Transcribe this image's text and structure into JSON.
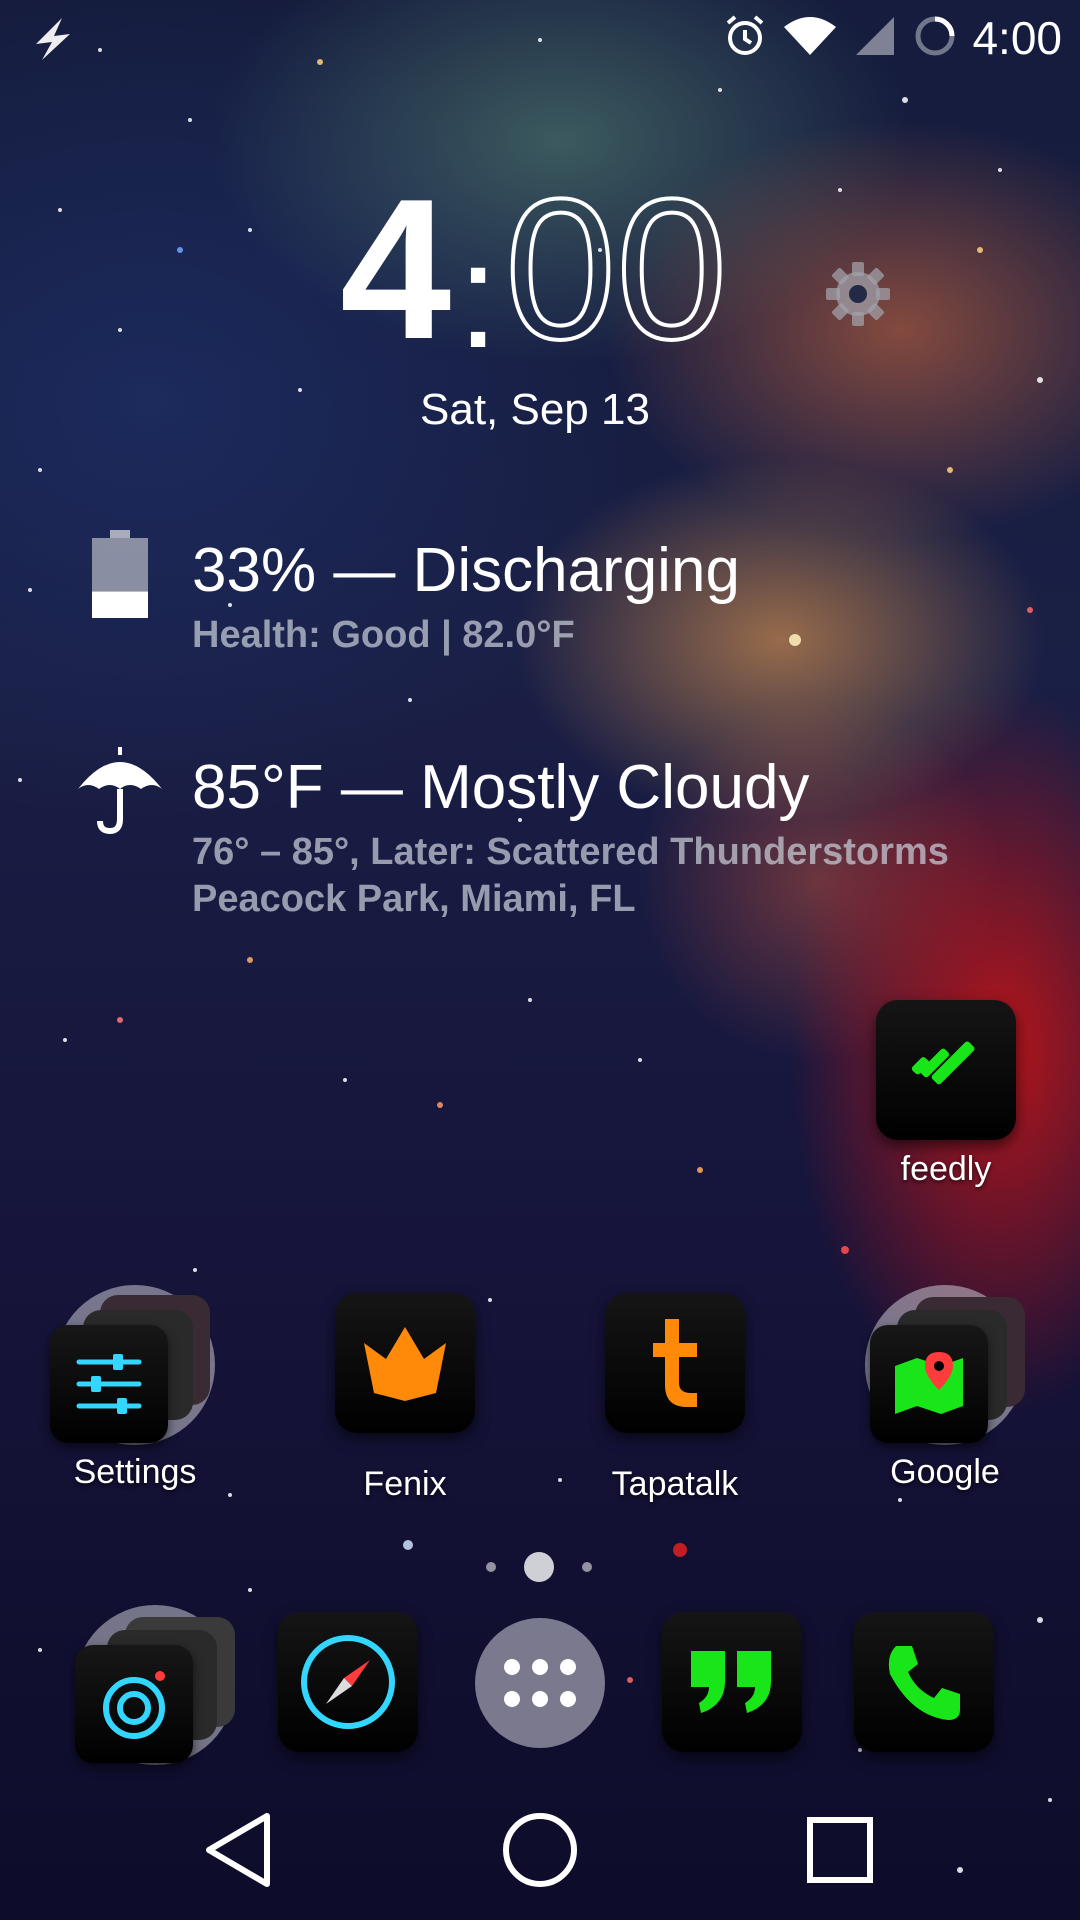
{
  "status_bar": {
    "time": "4:00"
  },
  "clock": {
    "hour": "4",
    "minute": "00",
    "date": "Sat, Sep 13"
  },
  "battery_widget": {
    "title": "33% — Discharging",
    "detail": "Health: Good | 82.0°F",
    "level": 0.33
  },
  "weather_widget": {
    "title": "85°F — Mostly Cloudy",
    "forecast": "76° – 85°, Later: Scattered Thunderstorms",
    "location": "Peacock Park, Miami, FL"
  },
  "desktop_apps": {
    "feedly": "feedly",
    "settings": "Settings",
    "fenix": "Fenix",
    "tapatalk": "Tapatalk",
    "google": "Google"
  },
  "page_indicator": {
    "pages": 3,
    "current": 2
  },
  "colors": {
    "neon_green": "#19e619",
    "neon_orange": "#ff8a0a",
    "neon_cyan": "#33d6ff",
    "neon_red": "#ff3b3b"
  },
  "dock": {
    "items": [
      "camera-folder-icon",
      "compass-icon",
      "app-drawer-icon",
      "hangouts-icon",
      "phone-icon"
    ]
  },
  "nav_bar": {
    "items": [
      "back-icon",
      "home-icon",
      "recents-icon"
    ]
  }
}
